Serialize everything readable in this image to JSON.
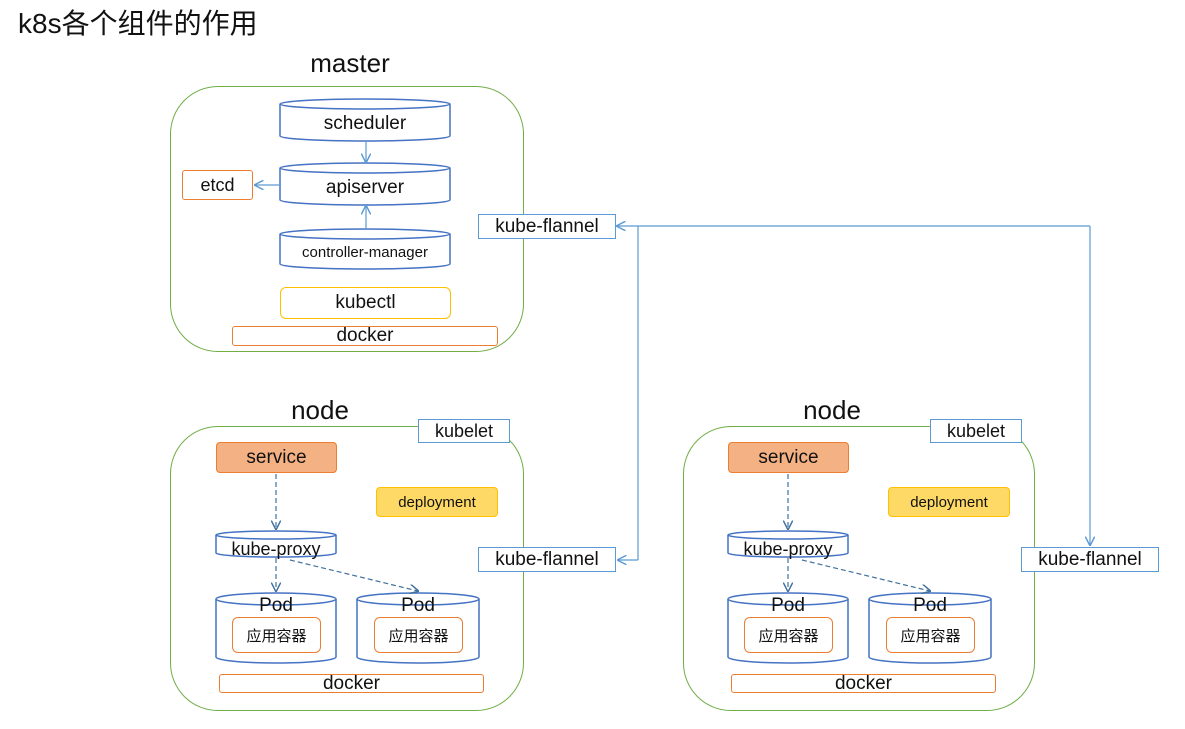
{
  "title": "k8s各个组件的作用",
  "master": {
    "label": "master",
    "scheduler": "scheduler",
    "apiserver": "apiserver",
    "controller_manager": "controller-manager",
    "etcd": "etcd",
    "kubectl": "kubectl",
    "docker": "docker",
    "flannel": "kube-flannel"
  },
  "nodes": [
    {
      "label": "node",
      "kubelet": "kubelet",
      "service": "service",
      "deployment": "deployment",
      "kube_proxy": "kube-proxy",
      "pods": [
        {
          "label": "Pod",
          "container": "应用容器"
        },
        {
          "label": "Pod",
          "container": "应用容器"
        }
      ],
      "docker": "docker",
      "flannel": "kube-flannel"
    },
    {
      "label": "node",
      "kubelet": "kubelet",
      "service": "service",
      "deployment": "deployment",
      "kube_proxy": "kube-proxy",
      "pods": [
        {
          "label": "Pod",
          "container": "应用容器"
        },
        {
          "label": "Pod",
          "container": "应用容器"
        }
      ],
      "docker": "docker",
      "flannel": "kube-flannel"
    }
  ],
  "colors": {
    "cluster_border": "#70ad47",
    "blue": "#4472c4",
    "orange": "#ed7d31",
    "service_fill": "#f4b183",
    "deployment_fill": "#ffd966",
    "yellow": "#ffc000",
    "arrow": "#5b9bd5"
  }
}
